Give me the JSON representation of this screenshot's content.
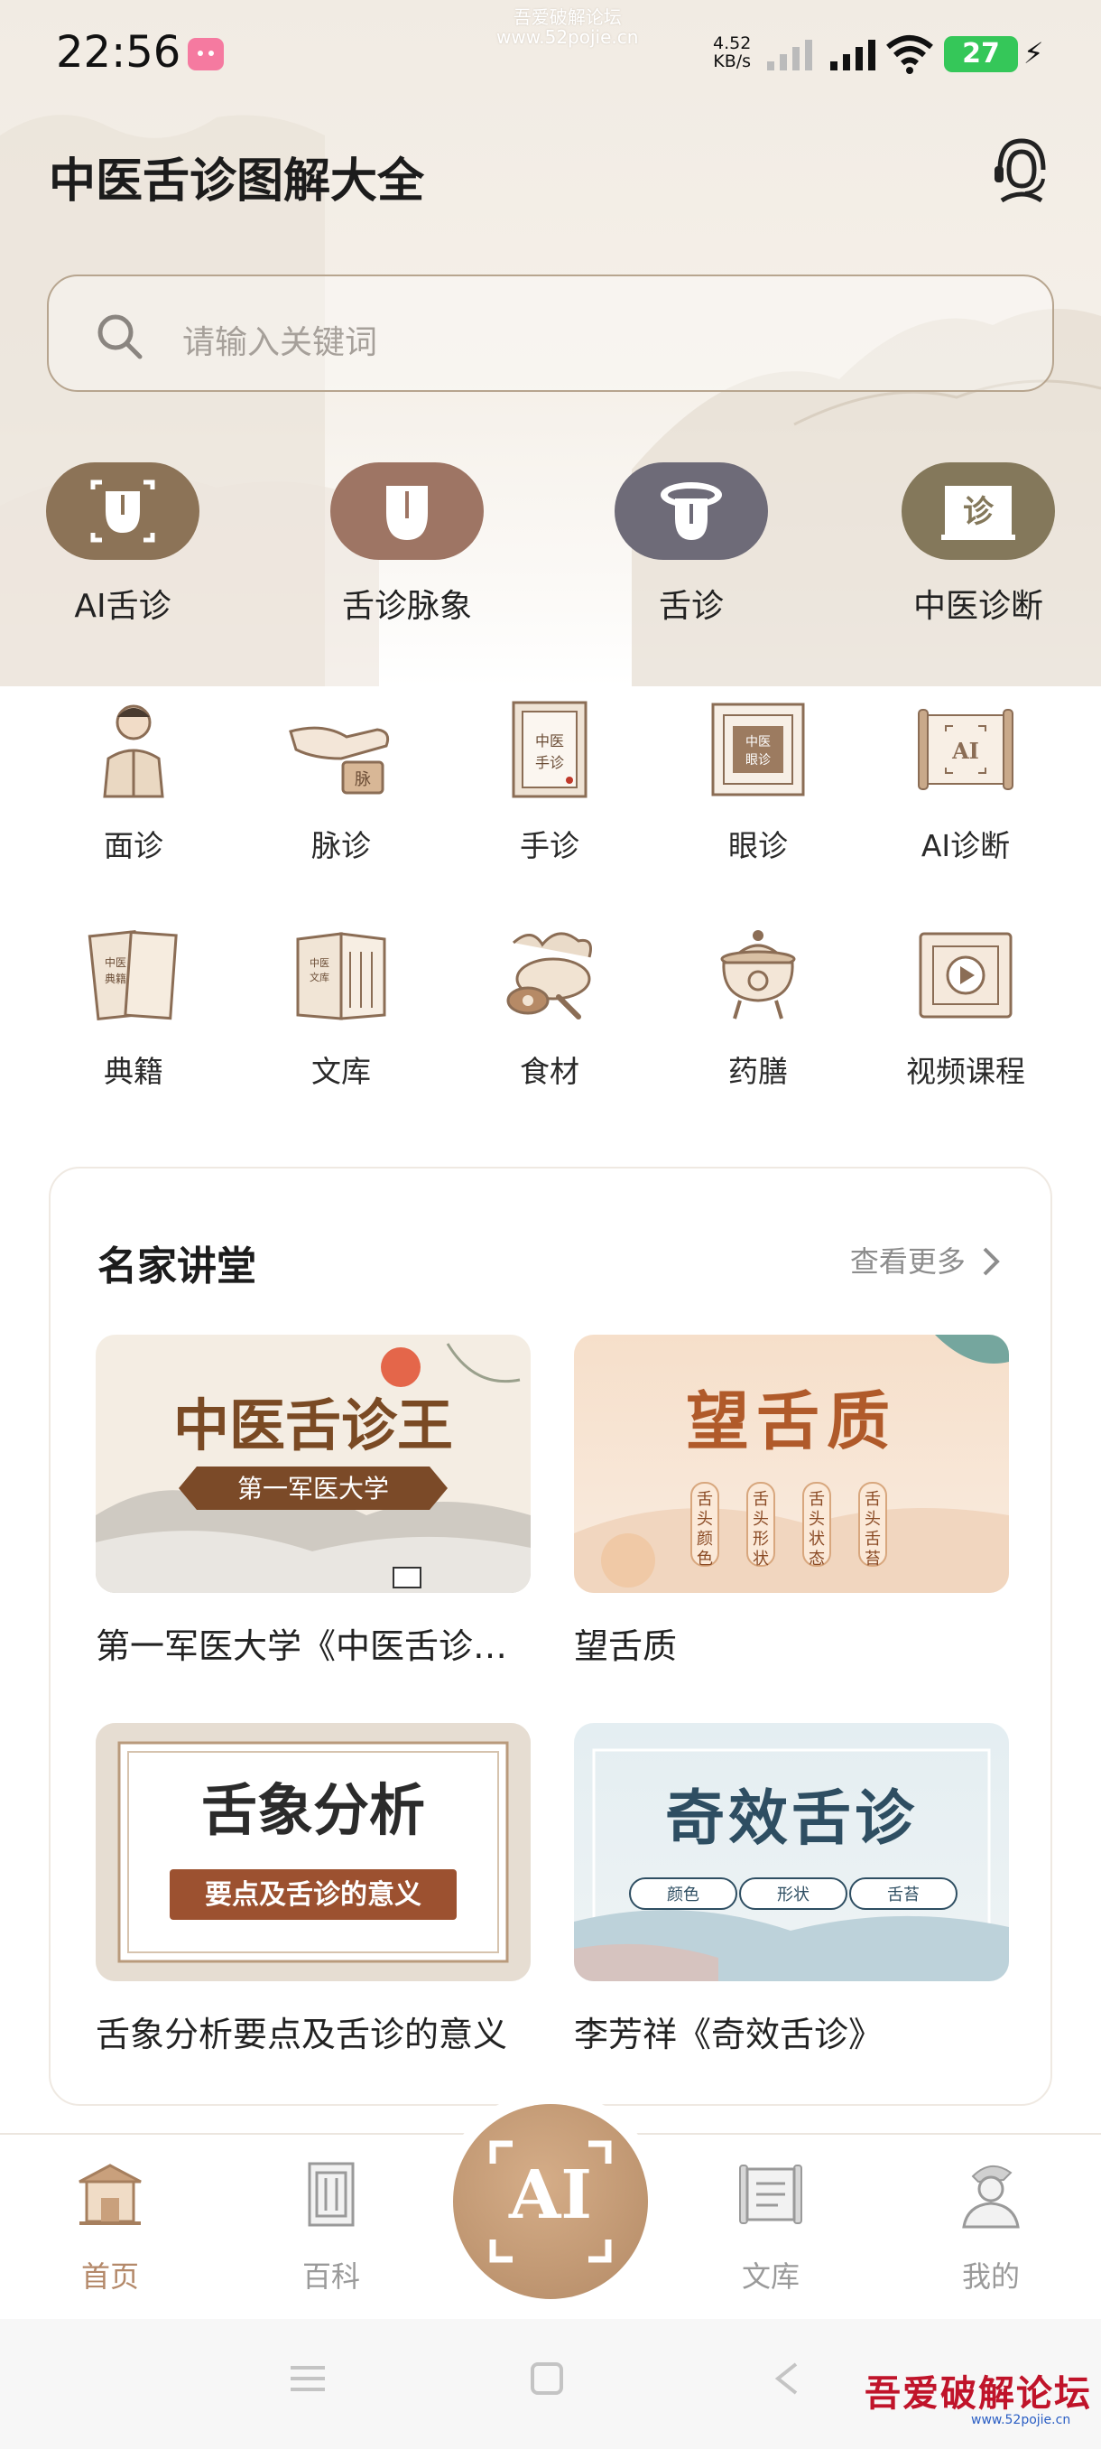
{
  "status_bar": {
    "time": "22:56",
    "net_speed_value": "4.52",
    "net_speed_unit": "KB/s",
    "battery": "27",
    "watermark_line1": "吾爱破解论坛",
    "watermark_line2": "www.52pojie.cn"
  },
  "header": {
    "title": "中医舌诊图解大全",
    "support_icon": "customer-service-icon"
  },
  "search": {
    "placeholder": "请输入关键词",
    "icon": "search-icon"
  },
  "top_categories": [
    {
      "label": "AI舌诊",
      "color": "#8c7357",
      "icon": "ai-tongue-scan-icon"
    },
    {
      "label": "舌诊脉象",
      "color": "#9e7564",
      "icon": "tongue-icon"
    },
    {
      "label": "舌诊",
      "color": "#6e6b78",
      "icon": "tongue-out-icon"
    },
    {
      "label": "中医诊断",
      "color": "#84785b",
      "icon": "diagnosis-scroll-icon",
      "glyph": "诊"
    }
  ],
  "grid_items": [
    {
      "label": "面诊",
      "icon": "doctor-icon"
    },
    {
      "label": "脉诊",
      "icon": "pulse-icon",
      "glyph": "脉"
    },
    {
      "label": "手诊",
      "icon": "hand-book-icon",
      "glyph": "中医手诊"
    },
    {
      "label": "眼诊",
      "icon": "eye-diagnosis-icon",
      "glyph": "中医眼诊"
    },
    {
      "label": "AI诊断",
      "icon": "ai-scroll-icon",
      "glyph": "AI"
    },
    {
      "label": "典籍",
      "icon": "classics-icon",
      "glyph": "中医典籍"
    },
    {
      "label": "文库",
      "icon": "library-book-icon",
      "glyph": "中医文库"
    },
    {
      "label": "食材",
      "icon": "ingredients-icon"
    },
    {
      "label": "药膳",
      "icon": "medicinal-cooking-icon"
    },
    {
      "label": "视频课程",
      "icon": "video-course-icon"
    }
  ],
  "lectures": {
    "title": "名家讲堂",
    "more": "查看更多",
    "items": [
      {
        "caption": "第一军医大学《中医舌诊…",
        "thumb_title": "中医舌诊王",
        "thumb_sub": "第一军医大学"
      },
      {
        "caption": "望舌质",
        "thumb_title": "望舌质",
        "tags": [
          "舌头颜色",
          "舌头形状",
          "舌头状态",
          "舌头舌苔"
        ]
      },
      {
        "caption": "舌象分析要点及舌诊的意义",
        "thumb_title": "舌象分析",
        "thumb_sub": "要点及舌诊的意义"
      },
      {
        "caption": "李芳祥《奇效舌诊》",
        "thumb_title": "奇效舌诊",
        "tags": [
          "颜色",
          "形状",
          "舌苔"
        ]
      }
    ]
  },
  "bottom_nav": {
    "tabs": [
      {
        "label": "首页",
        "icon": "home-pavilion-icon",
        "active": true
      },
      {
        "label": "百科",
        "icon": "encyclopedia-icon",
        "active": false
      },
      {
        "label": "文库",
        "icon": "library-scroll-icon",
        "active": false
      },
      {
        "label": "我的",
        "icon": "profile-icon",
        "active": false
      }
    ],
    "center_button": "AI",
    "accent_color": "#b4896a"
  },
  "forum_watermark": {
    "name": "吾爱破解论坛",
    "url": "www.52pojie.cn"
  }
}
